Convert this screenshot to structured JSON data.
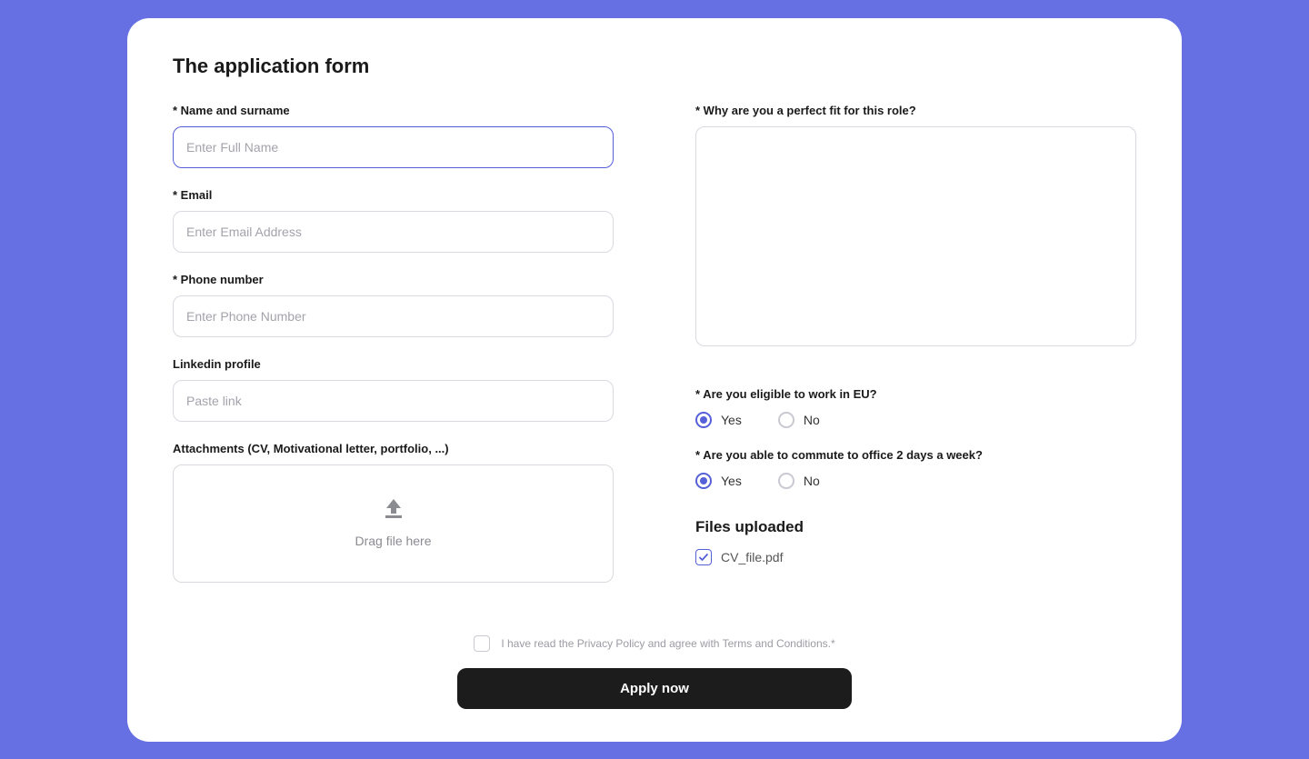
{
  "title": "The application form",
  "left": {
    "name": {
      "label": "* Name and surname",
      "placeholder": "Enter Full Name"
    },
    "email": {
      "label": "* Email",
      "placeholder": "Enter Email Address"
    },
    "phone": {
      "label": "* Phone number",
      "placeholder": "Enter Phone Number"
    },
    "linkedin": {
      "label": "Linkedin profile",
      "placeholder": "Paste link"
    },
    "attachments": {
      "label": "Attachments (CV, Motivational letter, portfolio, ...)",
      "dropzone_text": "Drag file here"
    }
  },
  "right": {
    "fit": {
      "label": "* Why are you a perfect fit for this role?"
    },
    "eu": {
      "label": "* Are you eligible to work in EU?",
      "yes": "Yes",
      "no": "No"
    },
    "commute": {
      "label": "* Are you able to commute to office 2 days a week?",
      "yes": "Yes",
      "no": "No"
    },
    "files": {
      "heading": "Files uploaded",
      "file1": "CV_file.pdf"
    }
  },
  "footer": {
    "consent": "I have read the Privacy Policy and agree with Terms and Conditions.*",
    "submit": "Apply now"
  }
}
